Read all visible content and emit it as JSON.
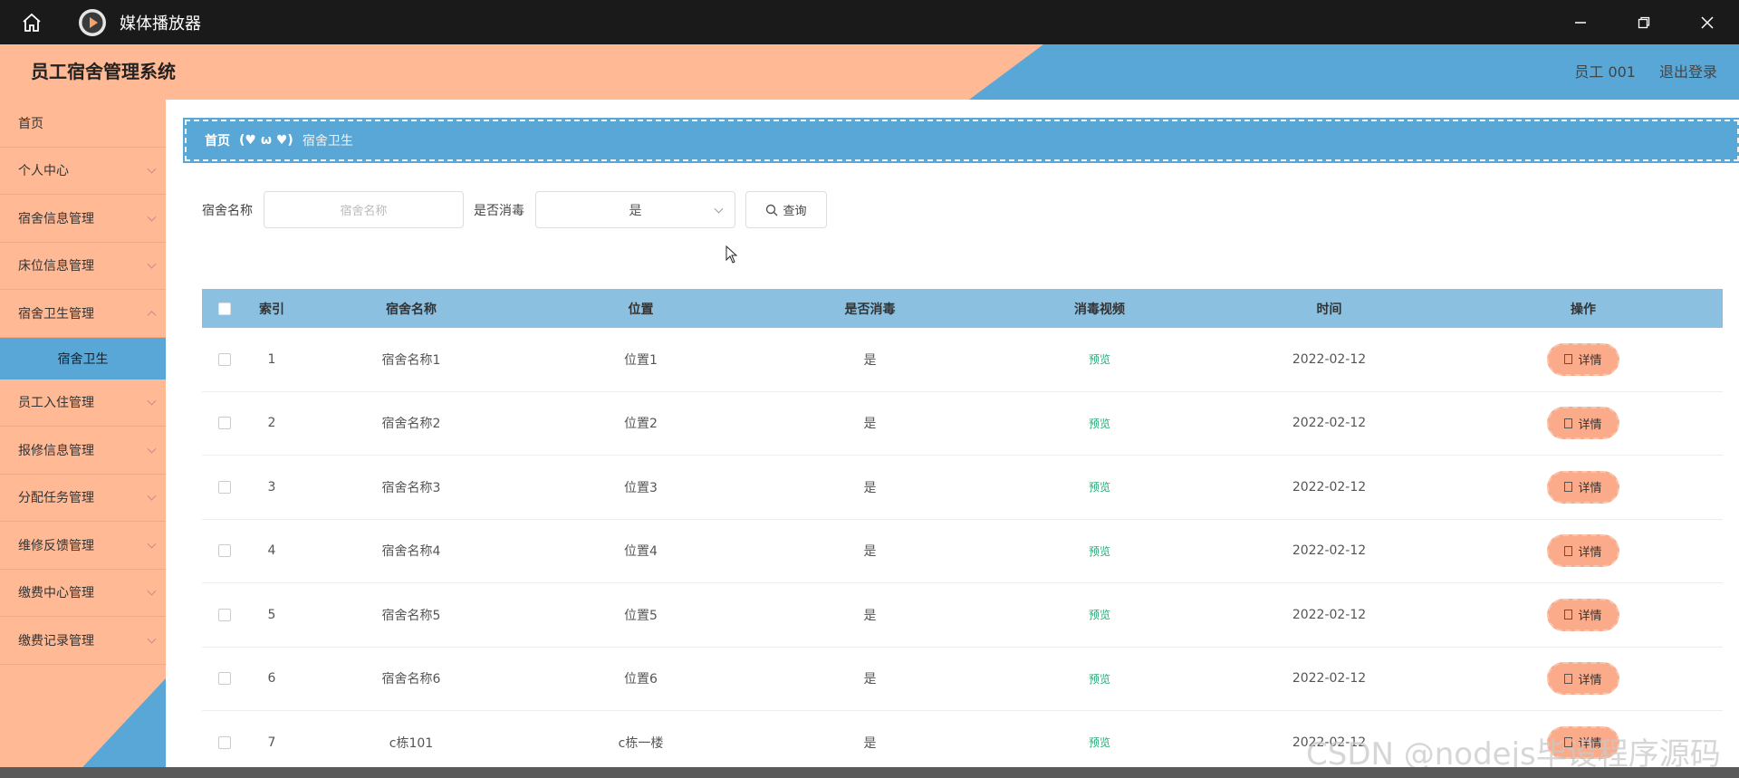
{
  "titlebar": {
    "app_title": "媒体播放器"
  },
  "header": {
    "system_title": "员工宿舍管理系统",
    "user": "员工 001",
    "logout": "退出登录"
  },
  "sidebar": {
    "items": [
      {
        "label": "首页",
        "expandable": false
      },
      {
        "label": "个人中心",
        "expandable": true
      },
      {
        "label": "宿舍信息管理",
        "expandable": true
      },
      {
        "label": "床位信息管理",
        "expandable": true
      },
      {
        "label": "宿舍卫生管理",
        "expandable": true
      },
      {
        "label": "宿舍卫生",
        "sub": true
      },
      {
        "label": "员工入住管理",
        "expandable": true
      },
      {
        "label": "报修信息管理",
        "expandable": true
      },
      {
        "label": "分配任务管理",
        "expandable": true
      },
      {
        "label": "维修反馈管理",
        "expandable": true
      },
      {
        "label": "缴费中心管理",
        "expandable": true
      },
      {
        "label": "缴费记录管理",
        "expandable": true
      }
    ]
  },
  "breadcrumb": {
    "home": "首页",
    "separator": "(♥ ω ♥)",
    "current": "宿舍卫生"
  },
  "search": {
    "name_label": "宿舍名称",
    "name_placeholder": "宿舍名称",
    "disinfect_label": "是否消毒",
    "disinfect_value": "是",
    "query_button": "查询"
  },
  "table": {
    "headers": [
      "索引",
      "宿舍名称",
      "位置",
      "是否消毒",
      "消毒视频",
      "时间",
      "操作"
    ],
    "rows": [
      {
        "index": "1",
        "name": "宿舍名称1",
        "location": "位置1",
        "disinfected": "是",
        "video": "预览",
        "time": "2022-02-12",
        "action": "详情"
      },
      {
        "index": "2",
        "name": "宿舍名称2",
        "location": "位置2",
        "disinfected": "是",
        "video": "预览",
        "time": "2022-02-12",
        "action": "详情"
      },
      {
        "index": "3",
        "name": "宿舍名称3",
        "location": "位置3",
        "disinfected": "是",
        "video": "预览",
        "time": "2022-02-12",
        "action": "详情"
      },
      {
        "index": "4",
        "name": "宿舍名称4",
        "location": "位置4",
        "disinfected": "是",
        "video": "预览",
        "time": "2022-02-12",
        "action": "详情"
      },
      {
        "index": "5",
        "name": "宿舍名称5",
        "location": "位置5",
        "disinfected": "是",
        "video": "预览",
        "time": "2022-02-12",
        "action": "详情"
      },
      {
        "index": "6",
        "name": "宿舍名称6",
        "location": "位置6",
        "disinfected": "是",
        "video": "预览",
        "time": "2022-02-12",
        "action": "详情"
      },
      {
        "index": "7",
        "name": "c栋101",
        "location": "c栋一楼",
        "disinfected": "是",
        "video": "预览",
        "time": "2022-02-12",
        "action": "详情"
      }
    ]
  },
  "watermark": "CSDN @nodejs毕设程序源码",
  "colors": {
    "peach": "#ffb994",
    "blue": "#59a7d6",
    "table_header": "#8bc0e0",
    "preview_green": "#2aa876"
  }
}
